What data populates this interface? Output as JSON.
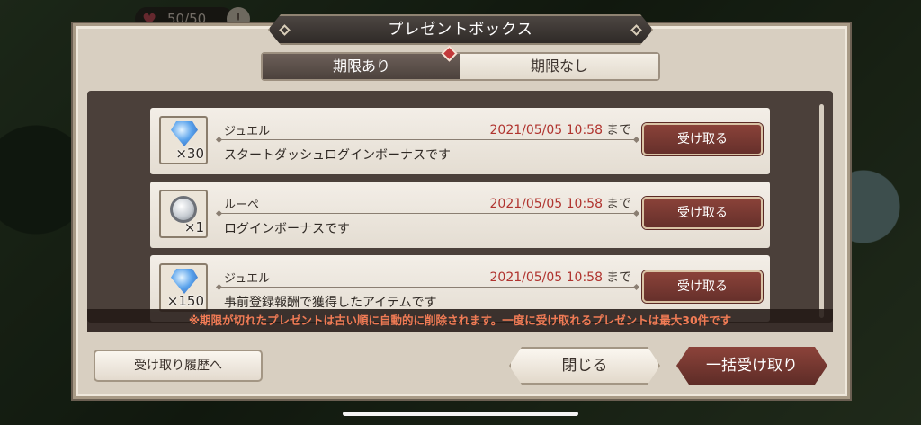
{
  "hud": {
    "stamina": "50/50"
  },
  "dialog": {
    "title": "プレゼントボックス",
    "tabs": [
      {
        "label": "期限あり",
        "active": true
      },
      {
        "label": "期限なし",
        "active": false
      }
    ],
    "items": [
      {
        "name": "ジュエル",
        "icon": "jewel-icon",
        "quantity": "×30",
        "expiry_date": "2021/05/05 10:58",
        "expiry_suffix": "まで",
        "description": "スタートダッシュログインボーナスです",
        "button_label": "受け取る"
      },
      {
        "name": "ルーペ",
        "icon": "loupe-icon",
        "quantity": "×1",
        "expiry_date": "2021/05/05 10:58",
        "expiry_suffix": "まで",
        "description": "ログインボーナスです",
        "button_label": "受け取る"
      },
      {
        "name": "ジュエル",
        "icon": "jewel-icon",
        "quantity": "×150",
        "expiry_date": "2021/05/05 10:58",
        "expiry_suffix": "まで",
        "description": "事前登録報酬で獲得したアイテムです",
        "button_label": "受け取る"
      }
    ],
    "notice": "※期限が切れたプレゼントは古い順に自動的に削除されます。一度に受け取れるプレゼントは最大30件です",
    "history_button": "受け取り履歴へ",
    "close_button": "閉じる",
    "bulk_receive_button": "一括受け取り"
  },
  "colors": {
    "accent_red": "#b0342f",
    "button_red": "#7a3a32",
    "notice_orange": "#f07b55"
  }
}
